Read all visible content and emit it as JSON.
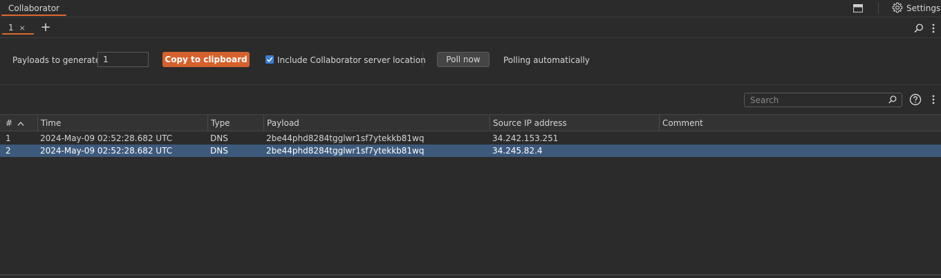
{
  "topbar": {
    "tab_label": "Collaborator",
    "settings_label": "Settings",
    "layout_icon": "panel-layout-icon",
    "settings_icon": "gear-icon"
  },
  "subtabs": {
    "items": [
      {
        "label": "1"
      }
    ],
    "close_glyph": "×",
    "add_glyph": "+"
  },
  "toolbar": {
    "payloads_label": "Payloads to generate:",
    "payloads_value": "1",
    "copy_label": "Copy to clipboard",
    "include_label": "Include Collaborator server location",
    "include_checked": true,
    "poll_label": "Poll now",
    "polling_status": "Polling automatically"
  },
  "search": {
    "placeholder": "Search"
  },
  "table": {
    "columns": [
      "#",
      "Time",
      "Type",
      "Payload",
      "Source IP address",
      "Comment"
    ],
    "rows": [
      {
        "num": "1",
        "time": "2024-May-09 02:52:28.682 UTC",
        "type": "DNS",
        "payload": "2be44phd8284tgglwr1sf7ytekkb81wq",
        "ip": "34.242.153.251",
        "comment": ""
      },
      {
        "num": "2",
        "time": "2024-May-09 02:52:28.682 UTC",
        "type": "DNS",
        "payload": "2be44phd8284tgglwr1sf7ytekkb81wq",
        "ip": "34.245.82.4",
        "comment": ""
      }
    ],
    "selected_row": 2
  },
  "colors": {
    "accent": "#e06a2c",
    "button": "#d5612c",
    "selection": "#3d5a7c",
    "checkbox": "#3c7fd0"
  }
}
